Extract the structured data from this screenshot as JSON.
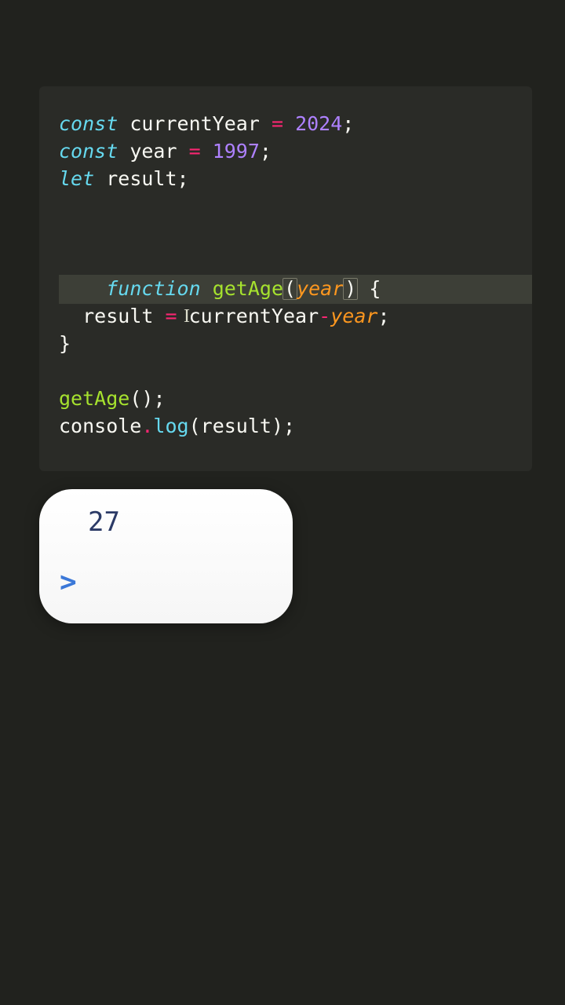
{
  "code": {
    "line1": {
      "kw": "const",
      "var": "currentYear",
      "op": " = ",
      "num": "2024",
      "semi": ";"
    },
    "line2": {
      "kw": "const",
      "var": "year",
      "op": " = ",
      "num": "1997",
      "semi": ";"
    },
    "line3": {
      "kw": "let",
      "var": "result",
      "semi": ";"
    },
    "line5": {
      "kw": "function",
      "fn": "getAge",
      "lp": "(",
      "param": "year",
      "rp": ")",
      "brace": " {"
    },
    "line6": {
      "indent": "  ",
      "var1": "result",
      "op1": " = ",
      "var2": "currentYear",
      "op2": "-",
      "var3": "year",
      "semi": ";"
    },
    "line7": {
      "brace": "}"
    },
    "line9": {
      "fn": "getAge",
      "lp": "(",
      "rp": ")",
      "semi": ";"
    },
    "line10": {
      "obj": "console",
      "dot": ".",
      "meth": "log",
      "lp": "(",
      "arg": "result",
      "rp": ")",
      "semi": ";"
    }
  },
  "console": {
    "output": "27",
    "prompt": ">"
  },
  "cursor_glyph": "I"
}
